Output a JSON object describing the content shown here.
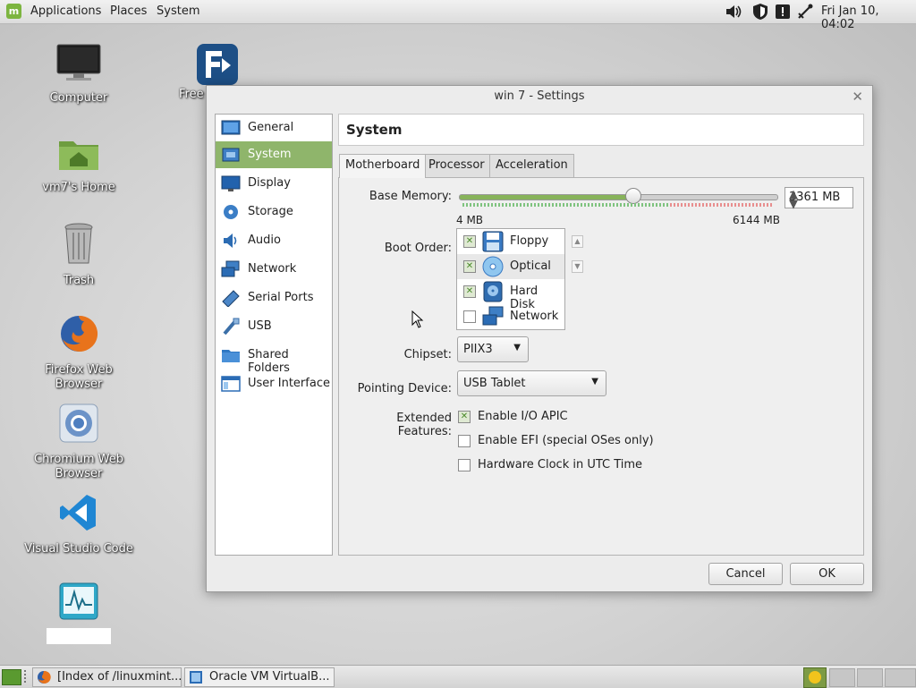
{
  "top_panel": {
    "menu": [
      "Applications",
      "Places",
      "System"
    ],
    "clock": "Fri Jan 10, 04:02"
  },
  "desktop": {
    "icons": [
      {
        "label": "Computer",
        "icon": "computer-icon"
      },
      {
        "label": "vm7's Home",
        "icon": "home-folder-icon"
      },
      {
        "label": "Trash",
        "icon": "trash-icon"
      },
      {
        "label": "Firefox Web Browser",
        "icon": "firefox-icon"
      },
      {
        "label": "Chromium Web Browser",
        "icon": "chromium-icon"
      },
      {
        "label": "Visual Studio Code",
        "icon": "vscode-icon"
      },
      {
        "label": "Free",
        "icon": "freefilesync-icon"
      }
    ]
  },
  "dialog": {
    "title": "win 7 - Settings",
    "sidebar": [
      {
        "label": "General",
        "icon": "general-icon"
      },
      {
        "label": "System",
        "icon": "system-icon",
        "selected": true
      },
      {
        "label": "Display",
        "icon": "display-icon"
      },
      {
        "label": "Storage",
        "icon": "storage-icon"
      },
      {
        "label": "Audio",
        "icon": "audio-icon"
      },
      {
        "label": "Network",
        "icon": "network-icon"
      },
      {
        "label": "Serial Ports",
        "icon": "serial-ports-icon"
      },
      {
        "label": "USB",
        "icon": "usb-icon"
      },
      {
        "label": "Shared Folders",
        "icon": "shared-folders-icon"
      },
      {
        "label": "User Interface",
        "icon": "user-interface-icon"
      }
    ],
    "section_title": "System",
    "tabs": [
      "Motherboard",
      "Processor",
      "Acceleration"
    ],
    "active_tab": "Motherboard",
    "base_memory": {
      "label": "Base Memory:",
      "value": "3361 MB",
      "min_label": "4 MB",
      "max_label": "6144 MB",
      "slider_fraction": 0.547
    },
    "boot_order": {
      "label": "Boot Order:",
      "items": [
        {
          "label": "Floppy",
          "checked": true,
          "icon": "floppy-icon"
        },
        {
          "label": "Optical",
          "checked": true,
          "icon": "optical-disc-icon"
        },
        {
          "label": "Hard Disk",
          "checked": true,
          "icon": "hard-disk-icon"
        },
        {
          "label": "Network",
          "checked": false,
          "icon": "network-boot-icon"
        }
      ]
    },
    "chipset": {
      "label": "Chipset:",
      "value": "PIIX3"
    },
    "pointing_device": {
      "label": "Pointing Device:",
      "value": "USB Tablet"
    },
    "extended_features": {
      "label": "Extended Features:",
      "options": [
        {
          "label": "Enable I/O APIC",
          "checked": true
        },
        {
          "label": "Enable EFI (special OSes only)",
          "checked": false
        },
        {
          "label": "Hardware Clock in UTC Time",
          "checked": false
        }
      ]
    },
    "buttons": {
      "cancel": "Cancel",
      "ok": "OK"
    }
  },
  "taskbar": {
    "tasks": [
      "[Index of /linuxmint...",
      "Oracle VM VirtualB..."
    ]
  },
  "colors": {
    "accent": "#8fb56b",
    "mint_green": "#7db540"
  }
}
